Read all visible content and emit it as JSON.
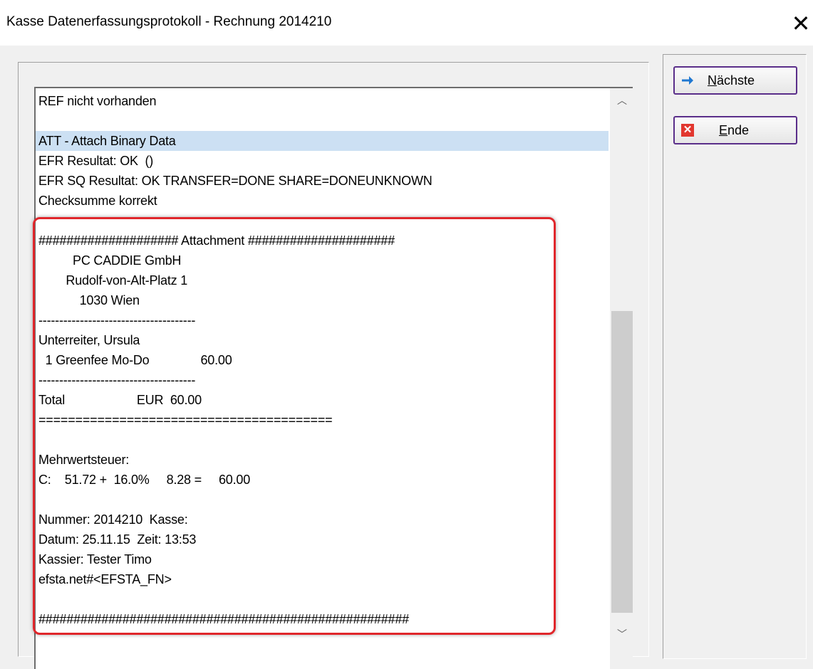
{
  "window": {
    "title": "Kasse Datenerfassungsprotokoll - Rechnung 2014210",
    "close_glyph": "✕"
  },
  "buttons": {
    "next_accel": "N",
    "next_rest": "ächste",
    "next_icon": "arrow-right-icon",
    "end_accel": "E",
    "end_rest": "nde",
    "end_icon": "close-red-icon"
  },
  "log": {
    "lines": [
      "REF nicht vorhanden",
      "",
      "ATT - Attach Binary Data",
      "EFR Resultat: OK  ()",
      "EFR SQ Resultat: OK TRANSFER=DONE SHARE=DONEUNKNOWN",
      "Checksumme korrekt",
      "",
      "#################### Attachment #####################",
      "          PC CADDIE GmbH",
      "        Rudolf-von-Alt-Platz 1",
      "            1030 Wien",
      "--------------------------------------",
      "Unterreiter, Ursula",
      "  1 Greenfee Mo-Do               60.00",
      "--------------------------------------",
      "Total                     EUR  60.00",
      "========================================",
      "",
      "Mehrwertsteuer:",
      "C:    51.72 +  16.0%     8.28 =     60.00",
      "",
      "Nummer: 2014210  Kasse:",
      "Datum: 25.11.15  Zeit: 13:53",
      "Kassier: Tester Timo",
      "efsta.net#<EFSTA_FN>",
      "",
      "#####################################################"
    ],
    "selected_index": 2
  },
  "colors": {
    "selection": "#cce0f3",
    "highlight_border": "#e0262b",
    "button_border": "#5a2e8a"
  }
}
